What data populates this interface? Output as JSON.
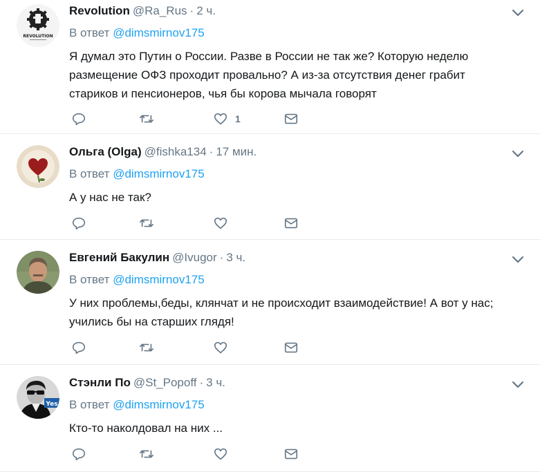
{
  "tweets": [
    {
      "name": "Revolution",
      "handle": "@Ra_Rus",
      "dot": "·",
      "time": "2 ч.",
      "reply_prefix": "В ответ",
      "reply_mention": "@dimsmirnov175",
      "text": "Я думал это Путин о России. Разве в России не так же? Которую неделю размещение ОФЗ проходит провально? А из-за отсутствия денег грабит стариков и пенсионеров, чья бы корова мычала говорят",
      "like_count": "1",
      "avatar_logo_text": "REVOLUTION"
    },
    {
      "name": "Ольга (Olga)",
      "handle": "@fishka134",
      "dot": "·",
      "time": "17 мин.",
      "reply_prefix": "В ответ",
      "reply_mention": "@dimsmirnov175",
      "text": "А у нас не так?",
      "like_count": ""
    },
    {
      "name": "Евгений Бакулин",
      "handle": "@Ivugor",
      "dot": "·",
      "time": "3 ч.",
      "reply_prefix": "В ответ",
      "reply_mention": "@dimsmirnov175",
      "text": "У них проблемы,беды, клянчат и не происходит взаимодействие! А вот у нас; учились бы на старших глядя!",
      "like_count": ""
    },
    {
      "name": "Стэнли По",
      "handle": "@St_Popoff",
      "dot": "·",
      "time": "3 ч.",
      "reply_prefix": "В ответ",
      "reply_mention": "@dimsmirnov175",
      "text": "Кто-то наколдовал на них ...",
      "like_count": "",
      "avatar_badge_text": "Yes"
    }
  ],
  "colors": {
    "text": "#14171a",
    "secondary": "#657786",
    "mention": "#1da1f2",
    "border": "#e6ecf0"
  },
  "icons": [
    "reply-icon",
    "retweet-icon",
    "like-icon",
    "direct-message-icon",
    "caret-down-icon"
  ]
}
